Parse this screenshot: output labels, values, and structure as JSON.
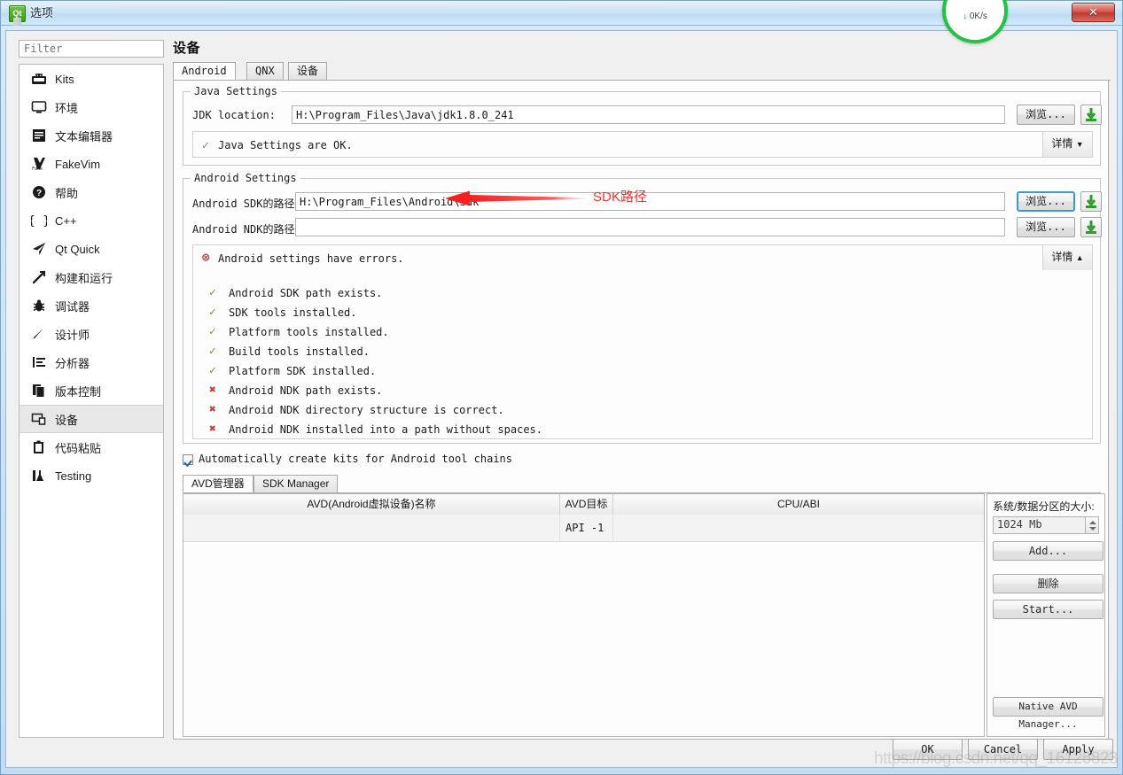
{
  "window": {
    "title": "选项",
    "icon": "qt-logo-icon",
    "close_label": "✕"
  },
  "sidebar": {
    "filter_placeholder": "Filter",
    "items": [
      {
        "label": "Kits",
        "icon": "kits-icon",
        "selected": false
      },
      {
        "label": "环境",
        "icon": "monitor-icon",
        "selected": false
      },
      {
        "label": "文本编辑器",
        "icon": "text-editor-icon",
        "selected": false
      },
      {
        "label": "FakeVim",
        "icon": "fakevim-icon",
        "selected": false
      },
      {
        "label": "帮助",
        "icon": "help-icon",
        "selected": false
      },
      {
        "label": "C++",
        "icon": "braces-icon",
        "selected": false
      },
      {
        "label": "Qt Quick",
        "icon": "qtquick-icon",
        "selected": false
      },
      {
        "label": "构建和运行",
        "icon": "hammer-icon",
        "selected": false
      },
      {
        "label": "调试器",
        "icon": "bug-icon",
        "selected": false
      },
      {
        "label": "设计师",
        "icon": "pen-icon",
        "selected": false
      },
      {
        "label": "分析器",
        "icon": "analyzer-icon",
        "selected": false
      },
      {
        "label": "版本控制",
        "icon": "version-control-icon",
        "selected": false
      },
      {
        "label": "设备",
        "icon": "device-icon",
        "selected": true
      },
      {
        "label": "代码粘贴",
        "icon": "clipboard-icon",
        "selected": false
      },
      {
        "label": "Testing",
        "icon": "testing-icon",
        "selected": false
      }
    ]
  },
  "page": {
    "title": "设备",
    "tabs": [
      {
        "label": "Android",
        "active": true
      },
      {
        "label": "QNX",
        "active": false
      },
      {
        "label": "设备",
        "active": false
      }
    ]
  },
  "java_settings": {
    "group_title": "Java Settings",
    "jdk_label": "JDK location:",
    "jdk_value": "H:\\Program_Files\\Java\\jdk1.8.0_241",
    "browse_label": "浏览...",
    "download_icon": "download-arrow-icon",
    "status_text": "Java Settings are OK.",
    "status_icon": "green-check-icon",
    "details_label": "详情",
    "details_arrow": "▼"
  },
  "android_settings": {
    "group_title": "Android Settings",
    "sdk_label": "Android SDK的路径:",
    "sdk_value": "H:\\Program_Files\\Android\\Sdk",
    "ndk_label": "Android NDK的路径:",
    "ndk_value": "",
    "browse_label": "浏览...",
    "status_text": "Android settings have errors.",
    "status_icon": "red-error-icon",
    "details_label": "详情",
    "details_arrow": "▲",
    "checks": [
      {
        "text": "Android SDK path exists.",
        "ok": true
      },
      {
        "text": "SDK tools installed.",
        "ok": true
      },
      {
        "text": "Platform tools installed.",
        "ok": true
      },
      {
        "text": "Build tools installed.",
        "ok": true
      },
      {
        "text": "Platform SDK installed.",
        "ok": true
      },
      {
        "text": "Android NDK path exists.",
        "ok": false
      },
      {
        "text": "Android NDK directory structure is correct.",
        "ok": false
      },
      {
        "text": "Android NDK installed into a path without spaces.",
        "ok": false
      }
    ],
    "auto_kits_label": "Automatically create kits for Android tool chains",
    "auto_kits_checked": true
  },
  "avd": {
    "tabs": [
      {
        "label": "AVD管理器",
        "active": true
      },
      {
        "label": "SDK Manager",
        "active": false
      }
    ],
    "columns": [
      "AVD(Android虚拟设备)名称",
      "AVD目标",
      "CPU/ABI"
    ],
    "rows": [
      {
        "name": "",
        "target": "API -1",
        "cpu": ""
      }
    ],
    "partition_label": "系统/数据分区的大小:",
    "partition_value": "1024 Mb",
    "buttons": [
      {
        "label": "Add...",
        "name": "add-avd-button"
      },
      {
        "label": "删除",
        "name": "delete-avd-button"
      },
      {
        "label": "Start...",
        "name": "start-avd-button"
      },
      {
        "label": "Native AVD Manager...",
        "name": "native-avd-manager-button"
      }
    ]
  },
  "dialog_buttons": [
    {
      "label": "OK",
      "name": "ok-button"
    },
    {
      "label": "Cancel",
      "name": "cancel-button"
    },
    {
      "label": "Apply",
      "name": "apply-button"
    }
  ],
  "annotation": {
    "text": "SDK路径",
    "color": "#ff2d2d"
  },
  "overlay": {
    "speed_down": "0K/s",
    "speed_up": "%",
    "watermark": "https://blog.csdn.net/qq_16126823"
  },
  "colors": {
    "accent_green": "#22c244",
    "error_red": "#d9382f",
    "ok_green": "#5aa832",
    "focus_blue": "#3a9ad9",
    "titlebar_blue": "#cfe4f7"
  }
}
